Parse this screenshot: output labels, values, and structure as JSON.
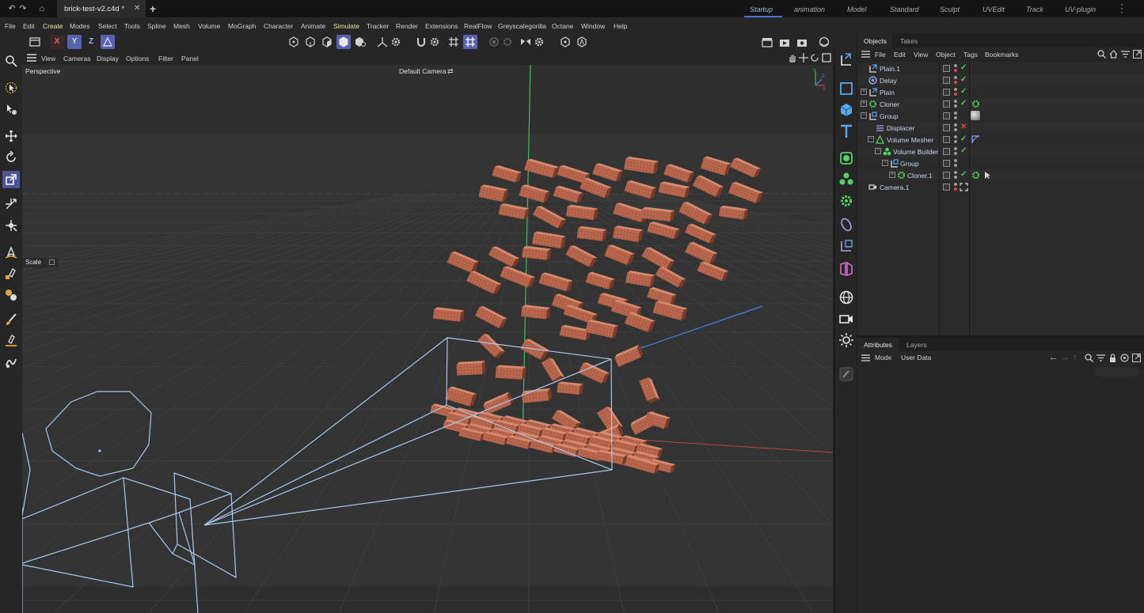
{
  "titlebar": {
    "document_tab": "brick-test-v2.c4d *",
    "layouts": [
      "Startup",
      "animation",
      "Model",
      "Standard",
      "Sculpt",
      "UVEdit",
      "Track",
      "UV-plugin"
    ],
    "active_layout": "Startup",
    "icons": [
      "undo-icon",
      "redo-icon",
      "home-icon",
      "close-tab-icon",
      "new-tab-icon",
      "more-icon"
    ]
  },
  "menubar": {
    "items": [
      "File",
      "Edit",
      "Create",
      "Modes",
      "Select",
      "Tools",
      "Spline",
      "Mesh",
      "Volume",
      "MoGraph",
      "Character",
      "Animate",
      "Simulate",
      "Tracker",
      "Render",
      "Extensions",
      "RealFlow",
      "Greyscalegorilla",
      "Octane",
      "Window",
      "Help"
    ],
    "highlighted": [
      "Create",
      "Simulate"
    ]
  },
  "toolbar": {
    "axis_x": "X",
    "axis_y": "Y",
    "axis_z": "Z"
  },
  "viewport": {
    "menu": [
      "View",
      "Cameras",
      "Display",
      "Options",
      "Filter",
      "Panel"
    ],
    "label": "Perspective",
    "camera": "Default Camera",
    "scale_label": "Scale",
    "accent_colors": {
      "y_axis": "#3fbf5a",
      "x_axis": "#c04646",
      "z_axis": "#4a7fe0",
      "camera_wire": "#a9c7ef",
      "brick": "#b5634a"
    }
  },
  "objects_panel": {
    "tabs": [
      "Objects",
      "Takes"
    ],
    "active_tab": "Objects",
    "menu": [
      "File",
      "Edit",
      "View",
      "Object",
      "Tags",
      "Bookmarks"
    ],
    "rows": [
      {
        "name": "Plain.1",
        "icon": "effector-icon",
        "status": "check"
      },
      {
        "name": "Delay",
        "icon": "delay-effector-icon",
        "status": "check"
      },
      {
        "name": "Plain",
        "icon": "effector-icon",
        "status": "check"
      },
      {
        "name": "Cloner",
        "icon": "cloner-icon",
        "status": "check"
      },
      {
        "name": "Group",
        "icon": "group-icon",
        "status": "none"
      },
      {
        "name": "Displacer",
        "icon": "displacer-icon",
        "status": "x"
      },
      {
        "name": "Volume Mesher",
        "icon": "volume-mesher-icon",
        "status": "check"
      },
      {
        "name": "Volume Builder",
        "icon": "volume-builder-icon",
        "status": "check"
      },
      {
        "name": "Group",
        "icon": "group-icon",
        "status": "none"
      },
      {
        "name": "Cloner.1",
        "icon": "cloner-icon",
        "status": "check"
      },
      {
        "name": "Camera.1",
        "icon": "camera-icon",
        "status": "none"
      }
    ]
  },
  "attributes_panel": {
    "tabs": [
      "Attributes",
      "Layers"
    ],
    "active_tab": "Attributes",
    "menu": [
      "Mode",
      "User Data"
    ]
  }
}
